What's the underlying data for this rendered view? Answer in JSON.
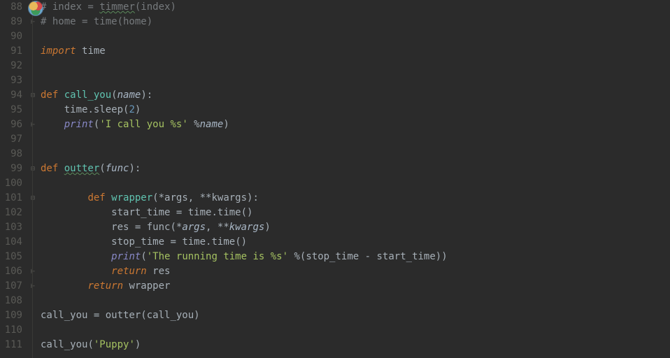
{
  "editor": {
    "first_line": 88,
    "last_line": 111,
    "lines": {
      "88": {
        "tokens": [
          {
            "t": "# index = ",
            "cls": "c-comment"
          },
          {
            "t": "timmer",
            "cls": "c-comment c-underline"
          },
          {
            "t": "(index)",
            "cls": "c-comment"
          }
        ],
        "fold": ""
      },
      "89": {
        "tokens": [
          {
            "t": "# home = time(home)",
            "cls": "c-comment"
          }
        ],
        "fold": "end"
      },
      "90": {
        "tokens": [],
        "fold": ""
      },
      "91": {
        "tokens": [
          {
            "t": "import",
            "cls": "c-keyword"
          },
          {
            "t": " ",
            "cls": "c-default"
          },
          {
            "t": "time",
            "cls": "c-default"
          }
        ],
        "fold": ""
      },
      "92": {
        "tokens": [],
        "fold": ""
      },
      "93": {
        "tokens": [],
        "fold": ""
      },
      "94": {
        "tokens": [
          {
            "t": "def ",
            "cls": "c-def"
          },
          {
            "t": "call_you",
            "cls": "c-fname"
          },
          {
            "t": "(",
            "cls": "c-punc"
          },
          {
            "t": "name",
            "cls": "c-param"
          },
          {
            "t": "):",
            "cls": "c-punc"
          }
        ],
        "fold": "open"
      },
      "95": {
        "tokens": [
          {
            "t": "    ",
            "cls": "c-default"
          },
          {
            "t": "time",
            "cls": "c-default"
          },
          {
            "t": ".",
            "cls": "c-dot"
          },
          {
            "t": "sleep",
            "cls": "c-default"
          },
          {
            "t": "(",
            "cls": "c-punc"
          },
          {
            "t": "2",
            "cls": "c-number"
          },
          {
            "t": ")",
            "cls": "c-punc"
          }
        ],
        "fold": ""
      },
      "96": {
        "tokens": [
          {
            "t": "    ",
            "cls": "c-default"
          },
          {
            "t": "print",
            "cls": "c-builtin"
          },
          {
            "t": "(",
            "cls": "c-punc"
          },
          {
            "t": "'I call you %s'",
            "cls": "c-string"
          },
          {
            "t": " %",
            "cls": "c-op"
          },
          {
            "t": "name",
            "cls": "c-param"
          },
          {
            "t": ")",
            "cls": "c-punc"
          }
        ],
        "fold": "end"
      },
      "97": {
        "tokens": [],
        "fold": ""
      },
      "98": {
        "tokens": [],
        "fold": ""
      },
      "99": {
        "tokens": [
          {
            "t": "def ",
            "cls": "c-def"
          },
          {
            "t": "outter",
            "cls": "c-fname c-underline"
          },
          {
            "t": "(",
            "cls": "c-punc"
          },
          {
            "t": "func",
            "cls": "c-param"
          },
          {
            "t": "):",
            "cls": "c-punc"
          }
        ],
        "fold": "open"
      },
      "100": {
        "tokens": [],
        "fold": ""
      },
      "101": {
        "tokens": [
          {
            "t": "        ",
            "cls": "c-default"
          },
          {
            "t": "def ",
            "cls": "c-def"
          },
          {
            "t": "wrapper",
            "cls": "c-fname"
          },
          {
            "t": "(*",
            "cls": "c-punc"
          },
          {
            "t": "args",
            "cls": "c-default"
          },
          {
            "t": ", **",
            "cls": "c-punc"
          },
          {
            "t": "kwargs",
            "cls": "c-default"
          },
          {
            "t": "):",
            "cls": "c-punc"
          }
        ],
        "fold": "open"
      },
      "102": {
        "tokens": [
          {
            "t": "            ",
            "cls": "c-default"
          },
          {
            "t": "start_time ",
            "cls": "c-default"
          },
          {
            "t": "= ",
            "cls": "c-op"
          },
          {
            "t": "time",
            "cls": "c-default"
          },
          {
            "t": ".",
            "cls": "c-dot"
          },
          {
            "t": "time",
            "cls": "c-default"
          },
          {
            "t": "()",
            "cls": "c-punc"
          }
        ],
        "fold": ""
      },
      "103": {
        "tokens": [
          {
            "t": "            ",
            "cls": "c-default"
          },
          {
            "t": "res ",
            "cls": "c-default"
          },
          {
            "t": "= ",
            "cls": "c-op"
          },
          {
            "t": "func",
            "cls": "c-default"
          },
          {
            "t": "(*",
            "cls": "c-punc"
          },
          {
            "t": "args",
            "cls": "c-param"
          },
          {
            "t": ", **",
            "cls": "c-punc"
          },
          {
            "t": "kwargs",
            "cls": "c-param"
          },
          {
            "t": ")",
            "cls": "c-punc"
          }
        ],
        "fold": ""
      },
      "104": {
        "tokens": [
          {
            "t": "            ",
            "cls": "c-default"
          },
          {
            "t": "stop_time ",
            "cls": "c-default"
          },
          {
            "t": "= ",
            "cls": "c-op"
          },
          {
            "t": "time",
            "cls": "c-default"
          },
          {
            "t": ".",
            "cls": "c-dot"
          },
          {
            "t": "time",
            "cls": "c-default"
          },
          {
            "t": "()",
            "cls": "c-punc"
          }
        ],
        "fold": ""
      },
      "105": {
        "tokens": [
          {
            "t": "            ",
            "cls": "c-default"
          },
          {
            "t": "print",
            "cls": "c-builtin"
          },
          {
            "t": "(",
            "cls": "c-punc"
          },
          {
            "t": "'The running time is %s'",
            "cls": "c-string"
          },
          {
            "t": " %",
            "cls": "c-op"
          },
          {
            "t": "(",
            "cls": "c-punc"
          },
          {
            "t": "stop_time ",
            "cls": "c-default"
          },
          {
            "t": "- ",
            "cls": "c-op"
          },
          {
            "t": "start_time",
            "cls": "c-default"
          },
          {
            "t": "))",
            "cls": "c-punc"
          }
        ],
        "fold": ""
      },
      "106": {
        "tokens": [
          {
            "t": "            ",
            "cls": "c-default"
          },
          {
            "t": "return",
            "cls": "c-keyword"
          },
          {
            "t": " res",
            "cls": "c-default"
          }
        ],
        "fold": "end"
      },
      "107": {
        "tokens": [
          {
            "t": "        ",
            "cls": "c-default"
          },
          {
            "t": "return",
            "cls": "c-keyword"
          },
          {
            "t": " wrapper",
            "cls": "c-default"
          }
        ],
        "fold": "end"
      },
      "108": {
        "tokens": [],
        "fold": ""
      },
      "109": {
        "tokens": [
          {
            "t": "call_you ",
            "cls": "c-default"
          },
          {
            "t": "= ",
            "cls": "c-op"
          },
          {
            "t": "outter",
            "cls": "c-fname-call"
          },
          {
            "t": "(",
            "cls": "c-punc"
          },
          {
            "t": "call_you",
            "cls": "c-default"
          },
          {
            "t": ")",
            "cls": "c-punc"
          }
        ],
        "fold": ""
      },
      "110": {
        "tokens": [],
        "fold": ""
      },
      "111": {
        "tokens": [
          {
            "t": "call_you",
            "cls": "c-fname-call"
          },
          {
            "t": "(",
            "cls": "c-punc"
          },
          {
            "t": "'Puppy'",
            "cls": "c-string"
          },
          {
            "t": ")",
            "cls": "c-punc"
          }
        ],
        "fold": ""
      }
    },
    "fold_glyphs": {
      "open": "⊟",
      "end": "⊢",
      "": ""
    }
  },
  "colors": {
    "background": "#2b2b2b",
    "gutter_fg": "#5a5a56",
    "default": "#a7b0b8",
    "comment": "#767a7d",
    "keyword": "#cc7832",
    "function_name": "#60c3b0",
    "param_italic": "#a9b7c6",
    "builtin": "#8888c6",
    "number": "#6897bb",
    "string": "#a5c261"
  }
}
